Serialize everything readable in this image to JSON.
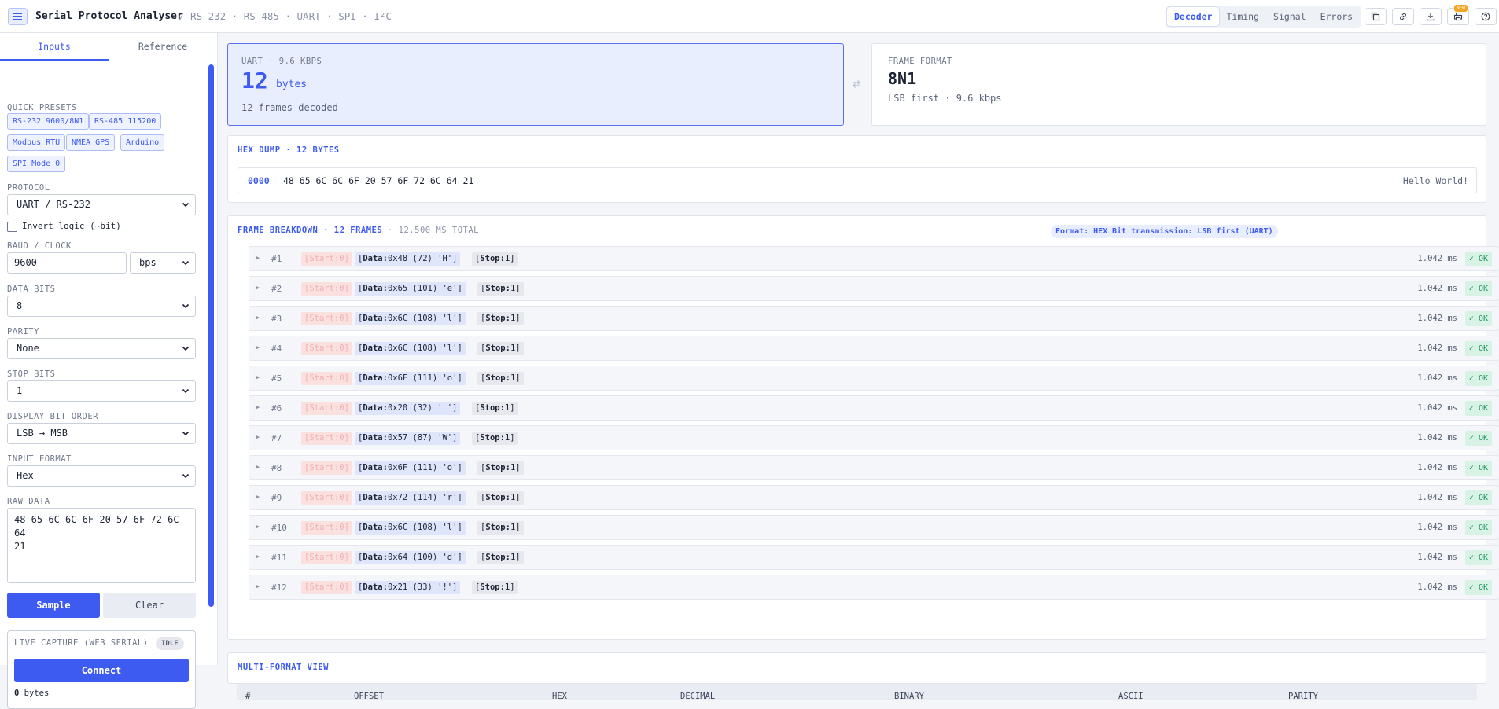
{
  "header": {
    "title": "Serial Protocol Analyser",
    "subtitle": "/ RS-232 · RS-485 · UART · SPI · I²C",
    "tabs": [
      "Decoder",
      "Timing",
      "Signal",
      "Errors"
    ],
    "active_tab": "Decoder",
    "new_badge": "NEW"
  },
  "sidebar": {
    "tabs": [
      "Inputs",
      "Reference"
    ],
    "quick_presets_label": "QUICK PRESETS",
    "presets": [
      "RS-232 9600/8N1",
      "RS-485 115200",
      "Modbus RTU",
      "NMEA GPS",
      "Arduino",
      "SPI Mode 0"
    ],
    "protocol_label": "PROTOCOL",
    "protocol_value": "UART / RS-232",
    "invert_label": "Invert logic (~bit)",
    "baud_label": "BAUD / CLOCK",
    "baud_value": "9600",
    "baud_unit": "bps",
    "data_bits_label": "DATA BITS",
    "data_bits_value": "8",
    "parity_label": "PARITY",
    "parity_value": "None",
    "stop_bits_label": "STOP BITS",
    "stop_bits_value": "1",
    "bit_order_label": "DISPLAY BIT ORDER",
    "bit_order_value": "LSB → MSB",
    "input_format_label": "INPUT FORMAT",
    "input_format_value": "Hex",
    "raw_data_label": "RAW DATA",
    "raw_data_value": "48 65 6C 6C 6F 20 57 6F 72 6C 64\n21",
    "sample_label": "Sample",
    "clear_label": "Clear",
    "capture_label": "LIVE CAPTURE (WEB SERIAL)",
    "capture_status": "IDLE",
    "connect_label": "Connect",
    "bytes_count": "0",
    "bytes_label": "bytes"
  },
  "summary": {
    "uart_head": "UART · 9.6 KBPS",
    "byte_count": "12",
    "byte_unit": "bytes",
    "frames_decoded": "12 frames decoded",
    "format_head": "FRAME FORMAT",
    "format_value": "8N1",
    "format_detail": "LSB first · 9.6 kbps"
  },
  "hexdump": {
    "title": "HEX DUMP · 12 BYTES",
    "offset": "0000",
    "bytes": "48 65 6C 6C 6F 20 57 6F 72 6C 64 21",
    "ascii": "Hello World!"
  },
  "breakdown": {
    "title": "FRAME BREAKDOWN · 12 FRAMES",
    "total": "· 12.500 MS TOTAL",
    "format_pill": "Format: HEX",
    "bit_pill": "Bit transmission: LSB first (UART)",
    "frames": [
      {
        "idx": "#1",
        "start": "[Start:0]",
        "data_key": "Data:",
        "data_val": "0x48 (72) 'H']",
        "stop_key": "Stop:",
        "stop_val": "1]",
        "dur": "1.042 ms",
        "status": "✓ OK"
      },
      {
        "idx": "#2",
        "start": "[Start:0]",
        "data_key": "Data:",
        "data_val": "0x65 (101) 'e']",
        "stop_key": "Stop:",
        "stop_val": "1]",
        "dur": "1.042 ms",
        "status": "✓ OK"
      },
      {
        "idx": "#3",
        "start": "[Start:0]",
        "data_key": "Data:",
        "data_val": "0x6C (108) 'l']",
        "stop_key": "Stop:",
        "stop_val": "1]",
        "dur": "1.042 ms",
        "status": "✓ OK"
      },
      {
        "idx": "#4",
        "start": "[Start:0]",
        "data_key": "Data:",
        "data_val": "0x6C (108) 'l']",
        "stop_key": "Stop:",
        "stop_val": "1]",
        "dur": "1.042 ms",
        "status": "✓ OK"
      },
      {
        "idx": "#5",
        "start": "[Start:0]",
        "data_key": "Data:",
        "data_val": "0x6F (111) 'o']",
        "stop_key": "Stop:",
        "stop_val": "1]",
        "dur": "1.042 ms",
        "status": "✓ OK"
      },
      {
        "idx": "#6",
        "start": "[Start:0]",
        "data_key": "Data:",
        "data_val": "0x20 (32) ' ']",
        "stop_key": "Stop:",
        "stop_val": "1]",
        "dur": "1.042 ms",
        "status": "✓ OK"
      },
      {
        "idx": "#7",
        "start": "[Start:0]",
        "data_key": "Data:",
        "data_val": "0x57 (87) 'W']",
        "stop_key": "Stop:",
        "stop_val": "1]",
        "dur": "1.042 ms",
        "status": "✓ OK"
      },
      {
        "idx": "#8",
        "start": "[Start:0]",
        "data_key": "Data:",
        "data_val": "0x6F (111) 'o']",
        "stop_key": "Stop:",
        "stop_val": "1]",
        "dur": "1.042 ms",
        "status": "✓ OK"
      },
      {
        "idx": "#9",
        "start": "[Start:0]",
        "data_key": "Data:",
        "data_val": "0x72 (114) 'r']",
        "stop_key": "Stop:",
        "stop_val": "1]",
        "dur": "1.042 ms",
        "status": "✓ OK"
      },
      {
        "idx": "#10",
        "start": "[Start:0]",
        "data_key": "Data:",
        "data_val": "0x6C (108) 'l']",
        "stop_key": "Stop:",
        "stop_val": "1]",
        "dur": "1.042 ms",
        "status": "✓ OK"
      },
      {
        "idx": "#11",
        "start": "[Start:0]",
        "data_key": "Data:",
        "data_val": "0x64 (100) 'd']",
        "stop_key": "Stop:",
        "stop_val": "1]",
        "dur": "1.042 ms",
        "status": "✓ OK"
      },
      {
        "idx": "#12",
        "start": "[Start:0]",
        "data_key": "Data:",
        "data_val": "0x21 (33) '!']",
        "stop_key": "Stop:",
        "stop_val": "1]",
        "dur": "1.042 ms",
        "status": "✓ OK"
      }
    ]
  },
  "multiformat": {
    "title": "MULTI-FORMAT VIEW",
    "columns": [
      "#",
      "OFFSET",
      "HEX",
      "DECIMAL",
      "BINARY",
      "ASCII",
      "PARITY"
    ]
  },
  "colors": {
    "accent": "#3d5af1",
    "ok_bg": "#d9f2e6",
    "ok_text": "#17955d",
    "start_bg": "#fbe0e0",
    "data_bg": "#dfe5fa"
  }
}
